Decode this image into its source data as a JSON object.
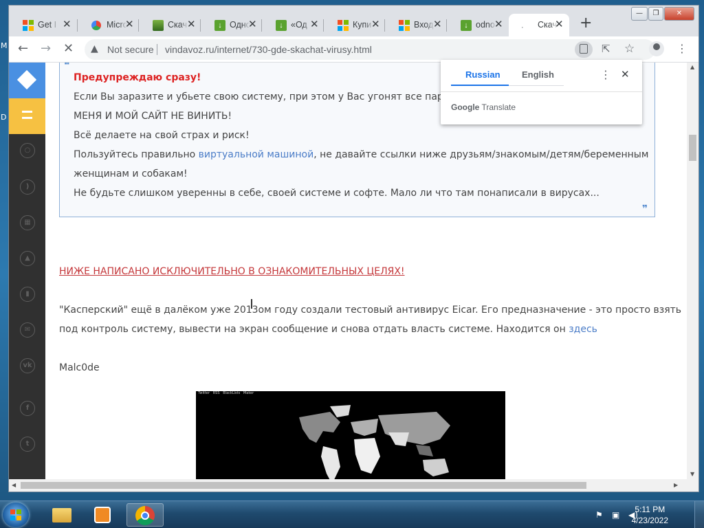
{
  "desktop": {
    "labels": [
      "M",
      "D"
    ]
  },
  "window": {
    "controls": [
      "—",
      "❐",
      "✕"
    ]
  },
  "tabs": [
    {
      "label": "Get I",
      "icon": "ms"
    },
    {
      "label": "Micro",
      "icon": "edge"
    },
    {
      "label": "Скач",
      "icon": "book"
    },
    {
      "label": "Одно",
      "icon": "dl"
    },
    {
      "label": "«Од",
      "icon": "dl"
    },
    {
      "label": "Купи",
      "icon": "ms"
    },
    {
      "label": "Вход",
      "icon": "ms"
    },
    {
      "label": "odno",
      "icon": "dl"
    },
    {
      "label": "Скач",
      "icon": "blank"
    }
  ],
  "toolbar": {
    "not_secure": "Not secure",
    "url": "vindavoz.ru/internet/730-gde-skachat-virusy.html"
  },
  "translate_popup": {
    "lang_from": "Russian",
    "lang_to": "English",
    "brand": "Google",
    "product": "Translate"
  },
  "quote": {
    "heading": "Предупреждаю сразу!",
    "line1": "Если Вы заразите и убьете свою систему, при этом у Вас угонят все пароли,",
    "line2": "МЕНЯ И МОЙ САЙТ НЕ ВИНИТЬ!",
    "line3": "Всё делаете на свой страх и риск!",
    "line4a": "Пользуйтесь правильно ",
    "line4_link": "виртуальной машиной",
    "line4b": ", не давайте ссылки ниже друзьям/знакомым/детям/беременным",
    "line5": "женщинам и собакам!",
    "line6": "Не будьте слишком уверенны в себе, своей системе и софте. Мало ли что там понаписали в вирусах..."
  },
  "article": {
    "warning_link": "НИЖЕ НАПИСАНО ИСКЛЮЧИТЕЛЬНО В ОЗНАКОМИТЕЛЬНЫХ ЦЕЛЯХ!",
    "para1_line1": "\"Касперский\" ещё в далёком уже 2013ом году создали тестовый антивирус Eicar. Его предназначение - это просто взять",
    "para1_line2": "под контроль систему, вывести на экран сообщение и снова отдать власть системе. Находится он ",
    "para1_link": "здесь",
    "malcode_link": "Malc0de",
    "map_menu": "  Twitter   RSS   BlackLists   Maker"
  },
  "taskbar": {
    "time": "5:11 PM",
    "date": "4/23/2022"
  }
}
